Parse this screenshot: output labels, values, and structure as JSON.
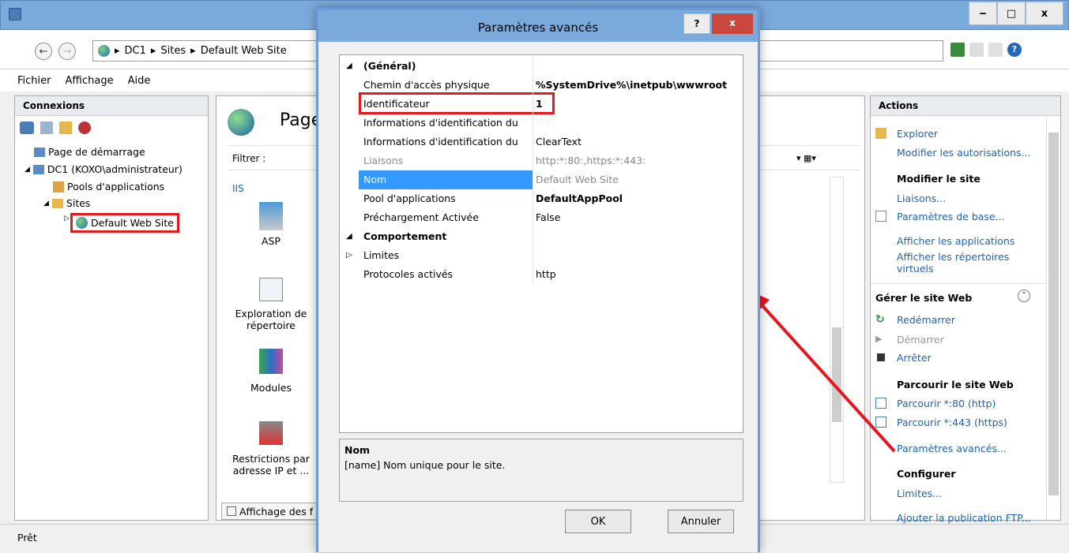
{
  "window": {
    "minimize": "‒",
    "maximize": "□",
    "close": "x"
  },
  "breadcrumb": [
    "DC1",
    "Sites",
    "Default Web Site"
  ],
  "menu": [
    "Fichier",
    "Affichage",
    "Aide"
  ],
  "connections": {
    "title": "Connexions",
    "tree": [
      "Page de démarrage",
      "DC1 (KOXO\\administrateur)",
      "Pools d'applications",
      "Sites",
      "Default Web Site"
    ]
  },
  "center": {
    "page_title": "Page",
    "filter_label": "Filtrer :",
    "group": "IIS",
    "icons": [
      "ASP",
      "Exploration de répertoire",
      "Modules",
      "Restrictions par adresse IP et ..."
    ],
    "view_tab": "Affichage des f"
  },
  "actions": {
    "title": "Actions",
    "explore": "Explorer",
    "edit_perms": "Modifier les autorisations...",
    "edit_site_header": "Modifier le site",
    "bindings": "Liaisons...",
    "basic_settings": "Paramètres de base...",
    "view_apps": "Afficher les applications",
    "view_vdirs": "Afficher les répertoires virtuels",
    "manage_header": "Gérer le site Web",
    "restart": "Redémarrer",
    "start": "Démarrer",
    "stop": "Arrêter",
    "browse_header": "Parcourir le site Web",
    "browse_http": "Parcourir *:80 (http)",
    "browse_https": "Parcourir *:443 (https)",
    "advanced": "Paramètres avancés...",
    "configure_header": "Configurer",
    "limits": "Limites...",
    "ftp": "Ajouter la publication FTP..."
  },
  "status": "Prêt",
  "dialog": {
    "title": "Paramètres avancés",
    "help": "?",
    "close": "x",
    "sections": {
      "general": "(Général)",
      "behavior": "Comportement"
    },
    "rows": [
      {
        "name": "Chemin d'accès physique",
        "value": "%SystemDrive%\\inetpub\\wwwroot"
      },
      {
        "name": "Identificateur",
        "value": "1"
      },
      {
        "name": "Informations d'identification du",
        "value": ""
      },
      {
        "name": "Informations d'identification du",
        "value": "ClearText"
      },
      {
        "name": "Liaisons",
        "value": "http:*:80:,https:*:443:"
      },
      {
        "name": "Nom",
        "value": "Default Web Site"
      },
      {
        "name": "Pool d'applications",
        "value": "DefaultAppPool"
      },
      {
        "name": "Préchargement Activée",
        "value": "False"
      }
    ],
    "behavior_rows": [
      {
        "name": "Limites",
        "value": ""
      },
      {
        "name": "Protocoles activés",
        "value": "http"
      }
    ],
    "desc_title": "Nom",
    "desc_text": "[name] Nom unique pour le site.",
    "ok": "OK",
    "cancel": "Annuler"
  },
  "colors": {
    "titlebar": "#7aa9dc",
    "highlight": "#e5181e",
    "selection": "#3399ff",
    "link": "#1c64b4"
  }
}
